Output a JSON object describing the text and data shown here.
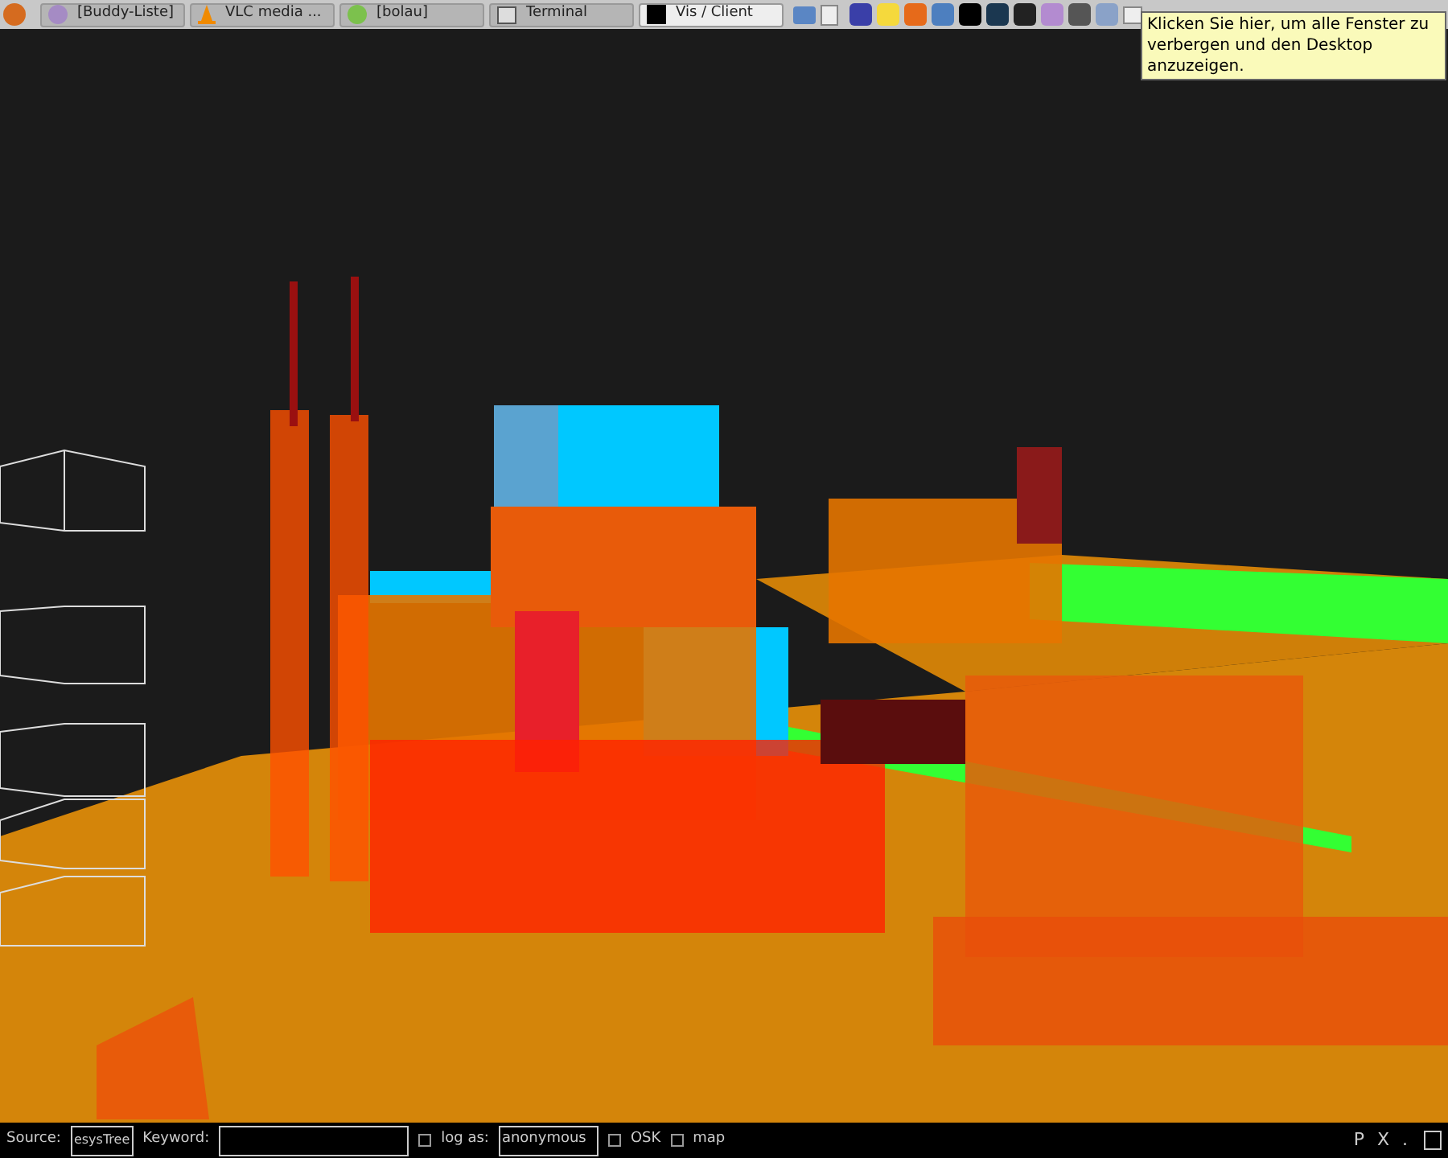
{
  "taskbar": {
    "tasks": [
      {
        "label": "[Buddy-Liste]",
        "selected": false,
        "kind": "chat"
      },
      {
        "label": "VLC media ...",
        "selected": false,
        "kind": "vlc"
      },
      {
        "label": "[bolau]",
        "selected": false,
        "kind": "status"
      },
      {
        "label": "Terminal",
        "selected": false,
        "kind": "terminal"
      },
      {
        "label": "Vis / Client",
        "selected": true,
        "kind": "app"
      }
    ]
  },
  "tooltip": {
    "text": "Klicken Sie hier, um alle Fenster zu verbergen und den Desktop anzuzeigen."
  },
  "bottom_bar": {
    "source_label": "Source:",
    "source_value": "esysTree",
    "keyword_label": "Keyword:",
    "options": [
      {
        "kind": "checkbox_field",
        "label": "log as:",
        "checked": false,
        "value": "anonymous"
      },
      {
        "kind": "checkbox",
        "label": "OSK",
        "checked": false
      },
      {
        "kind": "checkbox",
        "label": "map",
        "checked": false
      }
    ],
    "right_texts": [
      "P",
      "X",
      "."
    ]
  }
}
